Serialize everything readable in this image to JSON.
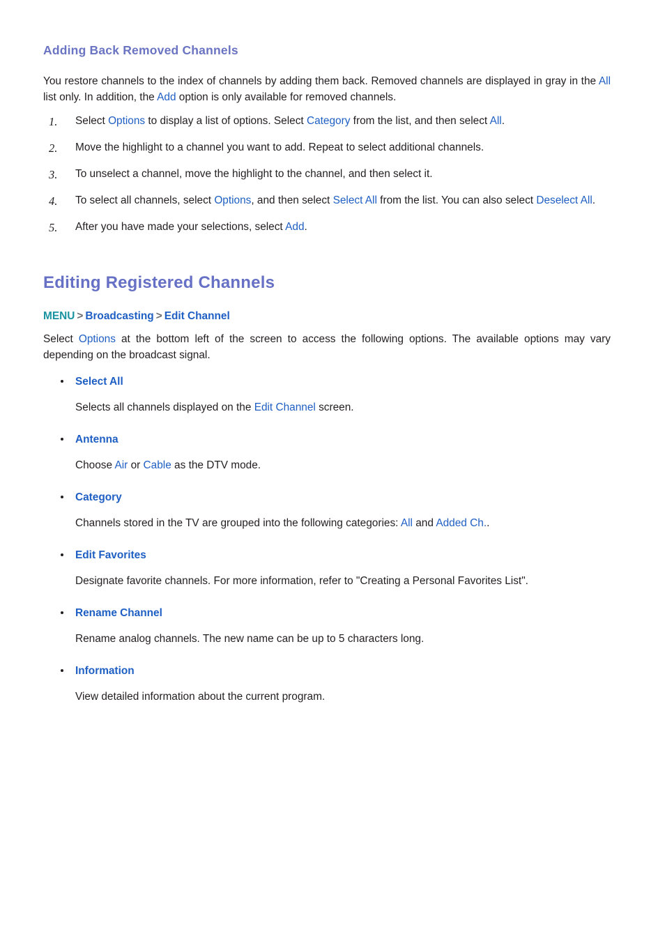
{
  "section1": {
    "heading": "Adding Back Removed Channels",
    "intro": {
      "p1": "You restore channels to the index of channels by adding them back. Removed channels are displayed in gray in the ",
      "link_all": "All",
      "p2": " list only. In addition, the ",
      "link_add": "Add",
      "p3": " option is only available for removed channels."
    },
    "steps": [
      {
        "num": "1.",
        "a": "Select ",
        "l1": "Options",
        "b": " to display a list of options. Select ",
        "l2": "Category",
        "c": " from the list, and then select ",
        "l3": "All",
        "d": "."
      },
      {
        "num": "2.",
        "a": "Move the highlight to a channel you want to add. Repeat to select additional channels.",
        "l1": "",
        "b": "",
        "l2": "",
        "c": "",
        "l3": "",
        "d": ""
      },
      {
        "num": "3.",
        "a": "To unselect a channel, move the highlight to the channel, and then select it.",
        "l1": "",
        "b": "",
        "l2": "",
        "c": "",
        "l3": "",
        "d": ""
      },
      {
        "num": "4.",
        "a": "To select all channels, select ",
        "l1": "Options",
        "b": ", and then select ",
        "l2": "Select All",
        "c": " from the list. You can also select ",
        "l3": "Deselect All",
        "d": "."
      },
      {
        "num": "5.",
        "a": "After you have made your selections, select ",
        "l1": "Add",
        "b": ".",
        "l2": "",
        "c": "",
        "l3": "",
        "d": ""
      }
    ]
  },
  "section2": {
    "heading": "Editing Registered Channels",
    "breadcrumb": {
      "menu": "MENU",
      "sep1": ">",
      "item1": "Broadcasting",
      "sep2": ">",
      "item2": "Edit Channel"
    },
    "intro": {
      "p1": "Select ",
      "link_options": "Options",
      "p2": " at the bottom left of the screen to access the following options. The available options may vary depending on the broadcast signal."
    },
    "options": [
      {
        "title": "Select All",
        "desc_a": "Selects all channels displayed on the ",
        "desc_l1": "Edit Channel",
        "desc_b": " screen.",
        "desc_l2": "",
        "desc_c": ""
      },
      {
        "title": "Antenna",
        "desc_a": "Choose ",
        "desc_l1": "Air",
        "desc_b": " or ",
        "desc_l2": "Cable",
        "desc_c": " as the DTV mode."
      },
      {
        "title": "Category",
        "desc_a": "Channels stored in the TV are grouped into the following categories: ",
        "desc_l1": "All",
        "desc_b": " and ",
        "desc_l2": "Added Ch.",
        "desc_c": "."
      },
      {
        "title": "Edit Favorites",
        "desc_a": "Designate favorite channels. For more information, refer to \"Creating a Personal Favorites List\".",
        "desc_l1": "",
        "desc_b": "",
        "desc_l2": "",
        "desc_c": ""
      },
      {
        "title": "Rename Channel",
        "desc_a": "Rename analog channels. The new name can be up to 5 characters long.",
        "desc_l1": "",
        "desc_b": "",
        "desc_l2": "",
        "desc_c": ""
      },
      {
        "title": "Information",
        "desc_a": "View detailed information about the current program.",
        "desc_l1": "",
        "desc_b": "",
        "desc_l2": "",
        "desc_c": ""
      }
    ]
  }
}
